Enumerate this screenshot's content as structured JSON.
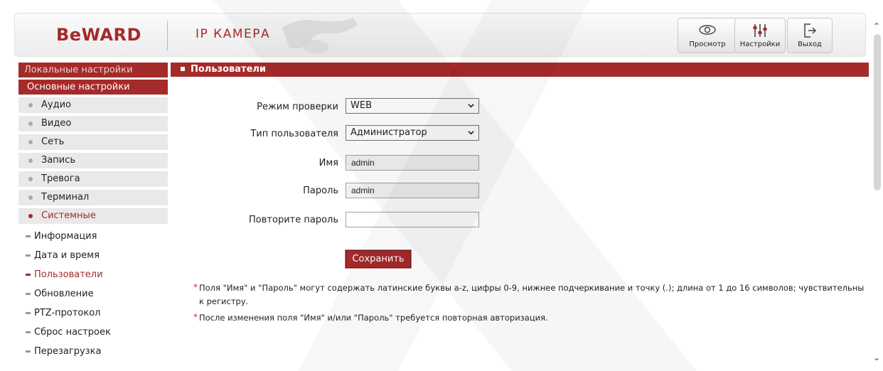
{
  "header": {
    "logo": "BeWARD",
    "product": "IP КАМЕРА",
    "buttons": {
      "view": "Просмотр",
      "settings": "Настройки",
      "exit": "Выход"
    }
  },
  "sidebar": {
    "local": "Локальные настройки",
    "basic": "Основные настройки",
    "items": [
      {
        "label": "Аудио"
      },
      {
        "label": "Видео"
      },
      {
        "label": "Сеть"
      },
      {
        "label": "Запись"
      },
      {
        "label": "Тревога"
      },
      {
        "label": "Терминал"
      },
      {
        "label": "Системные"
      }
    ],
    "subitems": [
      {
        "label": "Информация"
      },
      {
        "label": "Дата и время"
      },
      {
        "label": "Пользователи"
      },
      {
        "label": "Обновление"
      },
      {
        "label": "PTZ-протокол"
      },
      {
        "label": "Сброс настроек"
      },
      {
        "label": "Перезагрузка"
      }
    ]
  },
  "section": {
    "title": "Пользователи"
  },
  "form": {
    "mode_label": "Режим проверки",
    "mode_value": "WEB",
    "type_label": "Тип пользователя",
    "type_value": "Администратор",
    "name_label": "Имя",
    "name_value": "admin",
    "password_label": "Пароль",
    "password_value": "admin",
    "repeat_label": "Повторите пароль",
    "repeat_value": "",
    "save": "Сохранить"
  },
  "notes": {
    "note1": "Поля \"Имя\" и \"Пароль\" могут содержать латинские буквы a-z, цифры 0-9, нижнее подчеркивание и точку (.); длина от 1 до 16 символов; чувствительны к регистру.",
    "note2": "После изменения поля \"Имя\" и/или \"Пароль\" требуется повторная авторизация.",
    "asterisk": "*"
  },
  "colors": {
    "accent": "#a52a2a",
    "asterisk": "#d9262a"
  },
  "icons": [
    "eye-icon",
    "sliders-icon",
    "logout-icon",
    "chevron-down-icon",
    "scroll-up-icon",
    "scroll-down-icon"
  ]
}
